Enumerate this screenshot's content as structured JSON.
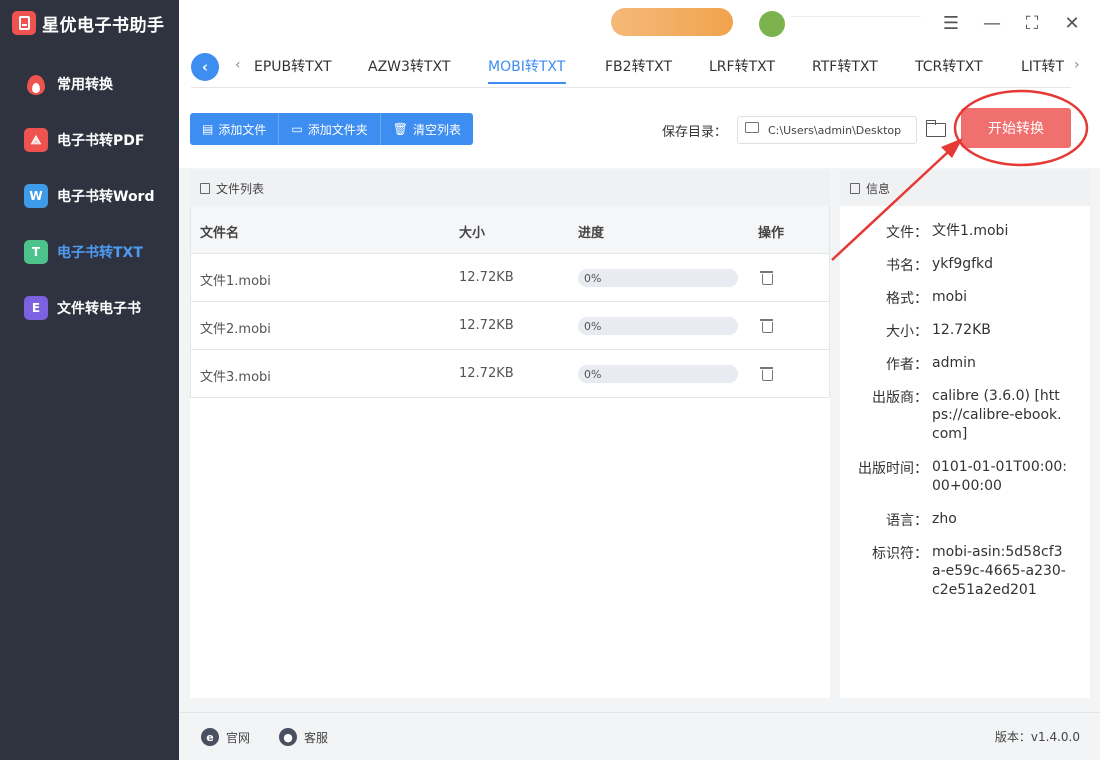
{
  "app": {
    "title": "星优电子书助手"
  },
  "sidebar": {
    "items": [
      {
        "label": "常用转换",
        "icon": "flame-icon",
        "color": "#ef5350"
      },
      {
        "label": "电子书转PDF",
        "icon": "pdf-icon",
        "color": "#ef5350"
      },
      {
        "label": "电子书转Word",
        "icon": "word-icon",
        "color": "#3d9be9",
        "letter": "W"
      },
      {
        "label": "电子书转TXT",
        "icon": "txt-icon",
        "color": "#4cc38a",
        "letter": "T",
        "active": true
      },
      {
        "label": "文件转电子书",
        "icon": "ebook-icon",
        "color": "#7c62e0",
        "letter": "E"
      }
    ]
  },
  "tabs": {
    "items": [
      "EPUB转TXT",
      "AZW3转TXT",
      "MOBI转TXT",
      "FB2转TXT",
      "LRF转TXT",
      "RTF转TXT",
      "TCR转TXT",
      "LIT转TXT"
    ],
    "active": "MOBI转TXT"
  },
  "toolbar": {
    "add_file": "添加文件",
    "add_folder": "添加文件夹",
    "clear_list": "清空列表",
    "save_dir_label": "保存目录：",
    "save_dir_value": "C:\\Users\\admin\\Desktop",
    "start": "开始转换"
  },
  "file_list": {
    "title": "文件列表",
    "columns": {
      "name": "文件名",
      "size": "大小",
      "progress": "进度",
      "action": "操作"
    },
    "rows": [
      {
        "name": "文件1.mobi",
        "size": "12.72KB",
        "progress": "0%",
        "progress_value": 0
      },
      {
        "name": "文件2.mobi",
        "size": "12.72KB",
        "progress": "0%",
        "progress_value": 0
      },
      {
        "name": "文件3.mobi",
        "size": "12.72KB",
        "progress": "0%",
        "progress_value": 0
      }
    ]
  },
  "info": {
    "title": "信息",
    "fields": [
      {
        "k": "文件：",
        "v": "文件1.mobi"
      },
      {
        "k": "书名：",
        "v": "ykf9gfkd"
      },
      {
        "k": "格式：",
        "v": "mobi"
      },
      {
        "k": "大小：",
        "v": "12.72KB"
      },
      {
        "k": "作者：",
        "v": "admin"
      },
      {
        "k": "出版商：",
        "v": "calibre (3.6.0) [https://calibre-ebook.com]"
      },
      {
        "k": "出版时间：",
        "v": "0101-01-01T00:00:00+00:00"
      },
      {
        "k": "语言：",
        "v": "zho"
      },
      {
        "k": "标识符：",
        "v": "mobi-asin:5d58cf3a-e59c-4665-a230-c2e51a2ed201"
      }
    ]
  },
  "footer": {
    "website": "官网",
    "support": "客服",
    "version": "版本：v1.4.0.0"
  },
  "colors": {
    "accent": "#3d8ef0",
    "start": "#f07070",
    "annotation": "#e53935",
    "sidebar": "#2f3340"
  }
}
